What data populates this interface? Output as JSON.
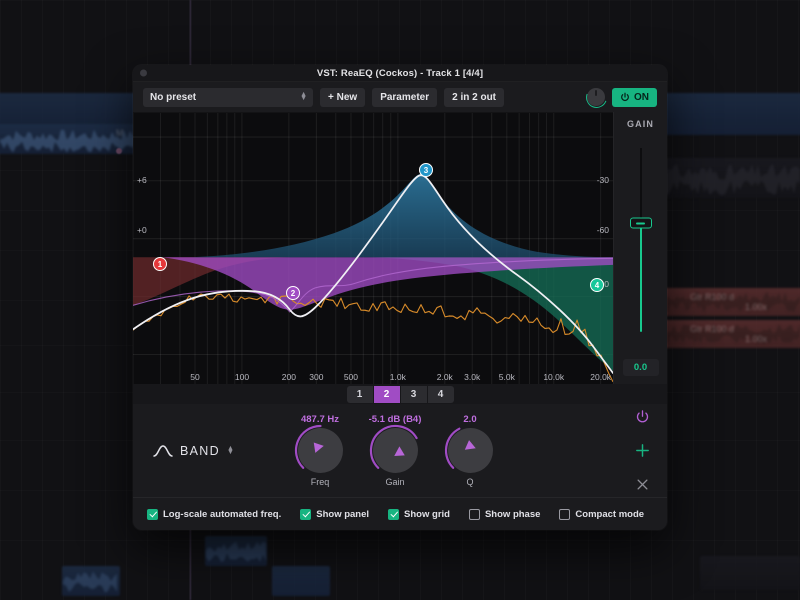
{
  "window": {
    "title": "VST: ReaEQ (Cockos) - Track  1 [4/4]"
  },
  "toolbar": {
    "preset_value": "No preset",
    "new_label": "+ New",
    "parameter_label": "Parameter",
    "io_label": "2 in 2 out",
    "power_label": "ON"
  },
  "graph": {
    "y_labels_left": [
      "+6",
      "+0"
    ],
    "y_labels_right": [
      "-30",
      "-60",
      "-90"
    ],
    "x_labels": [
      "50",
      "100",
      "200",
      "300",
      "500",
      "1.0k",
      "2.0k",
      "3.0k",
      "5.0k",
      "10.0k",
      "20.0k"
    ],
    "nodes": [
      {
        "id": "1",
        "color": "#e5383b"
      },
      {
        "id": "2",
        "color": "#a04cc4"
      },
      {
        "id": "3",
        "color": "#2196c9"
      },
      {
        "id": "4",
        "color": "#16c79a"
      }
    ],
    "curve_color": "#f0f0f4",
    "analyzer_color": "#d68a2a"
  },
  "gain": {
    "label": "GAIN",
    "value": "0.0",
    "accent": "#18c98e"
  },
  "bands": {
    "tabs": [
      "1",
      "2",
      "3",
      "4"
    ],
    "active": "2",
    "accent": "#a04cc4"
  },
  "band_panel": {
    "type_label": "BAND",
    "knobs": [
      {
        "name": "Freq",
        "value": "487.7 Hz"
      },
      {
        "name": "Gain",
        "value": "-5.1 dB (B4)"
      },
      {
        "name": "Q",
        "value": "2.0"
      }
    ]
  },
  "footer": {
    "checkboxes": [
      {
        "label": "Log-scale automated freq.",
        "checked": true
      },
      {
        "label": "Show panel",
        "checked": true
      },
      {
        "label": "Show grid",
        "checked": true
      },
      {
        "label": "Show phase",
        "checked": false
      },
      {
        "label": "Compact mode",
        "checked": false
      }
    ]
  }
}
